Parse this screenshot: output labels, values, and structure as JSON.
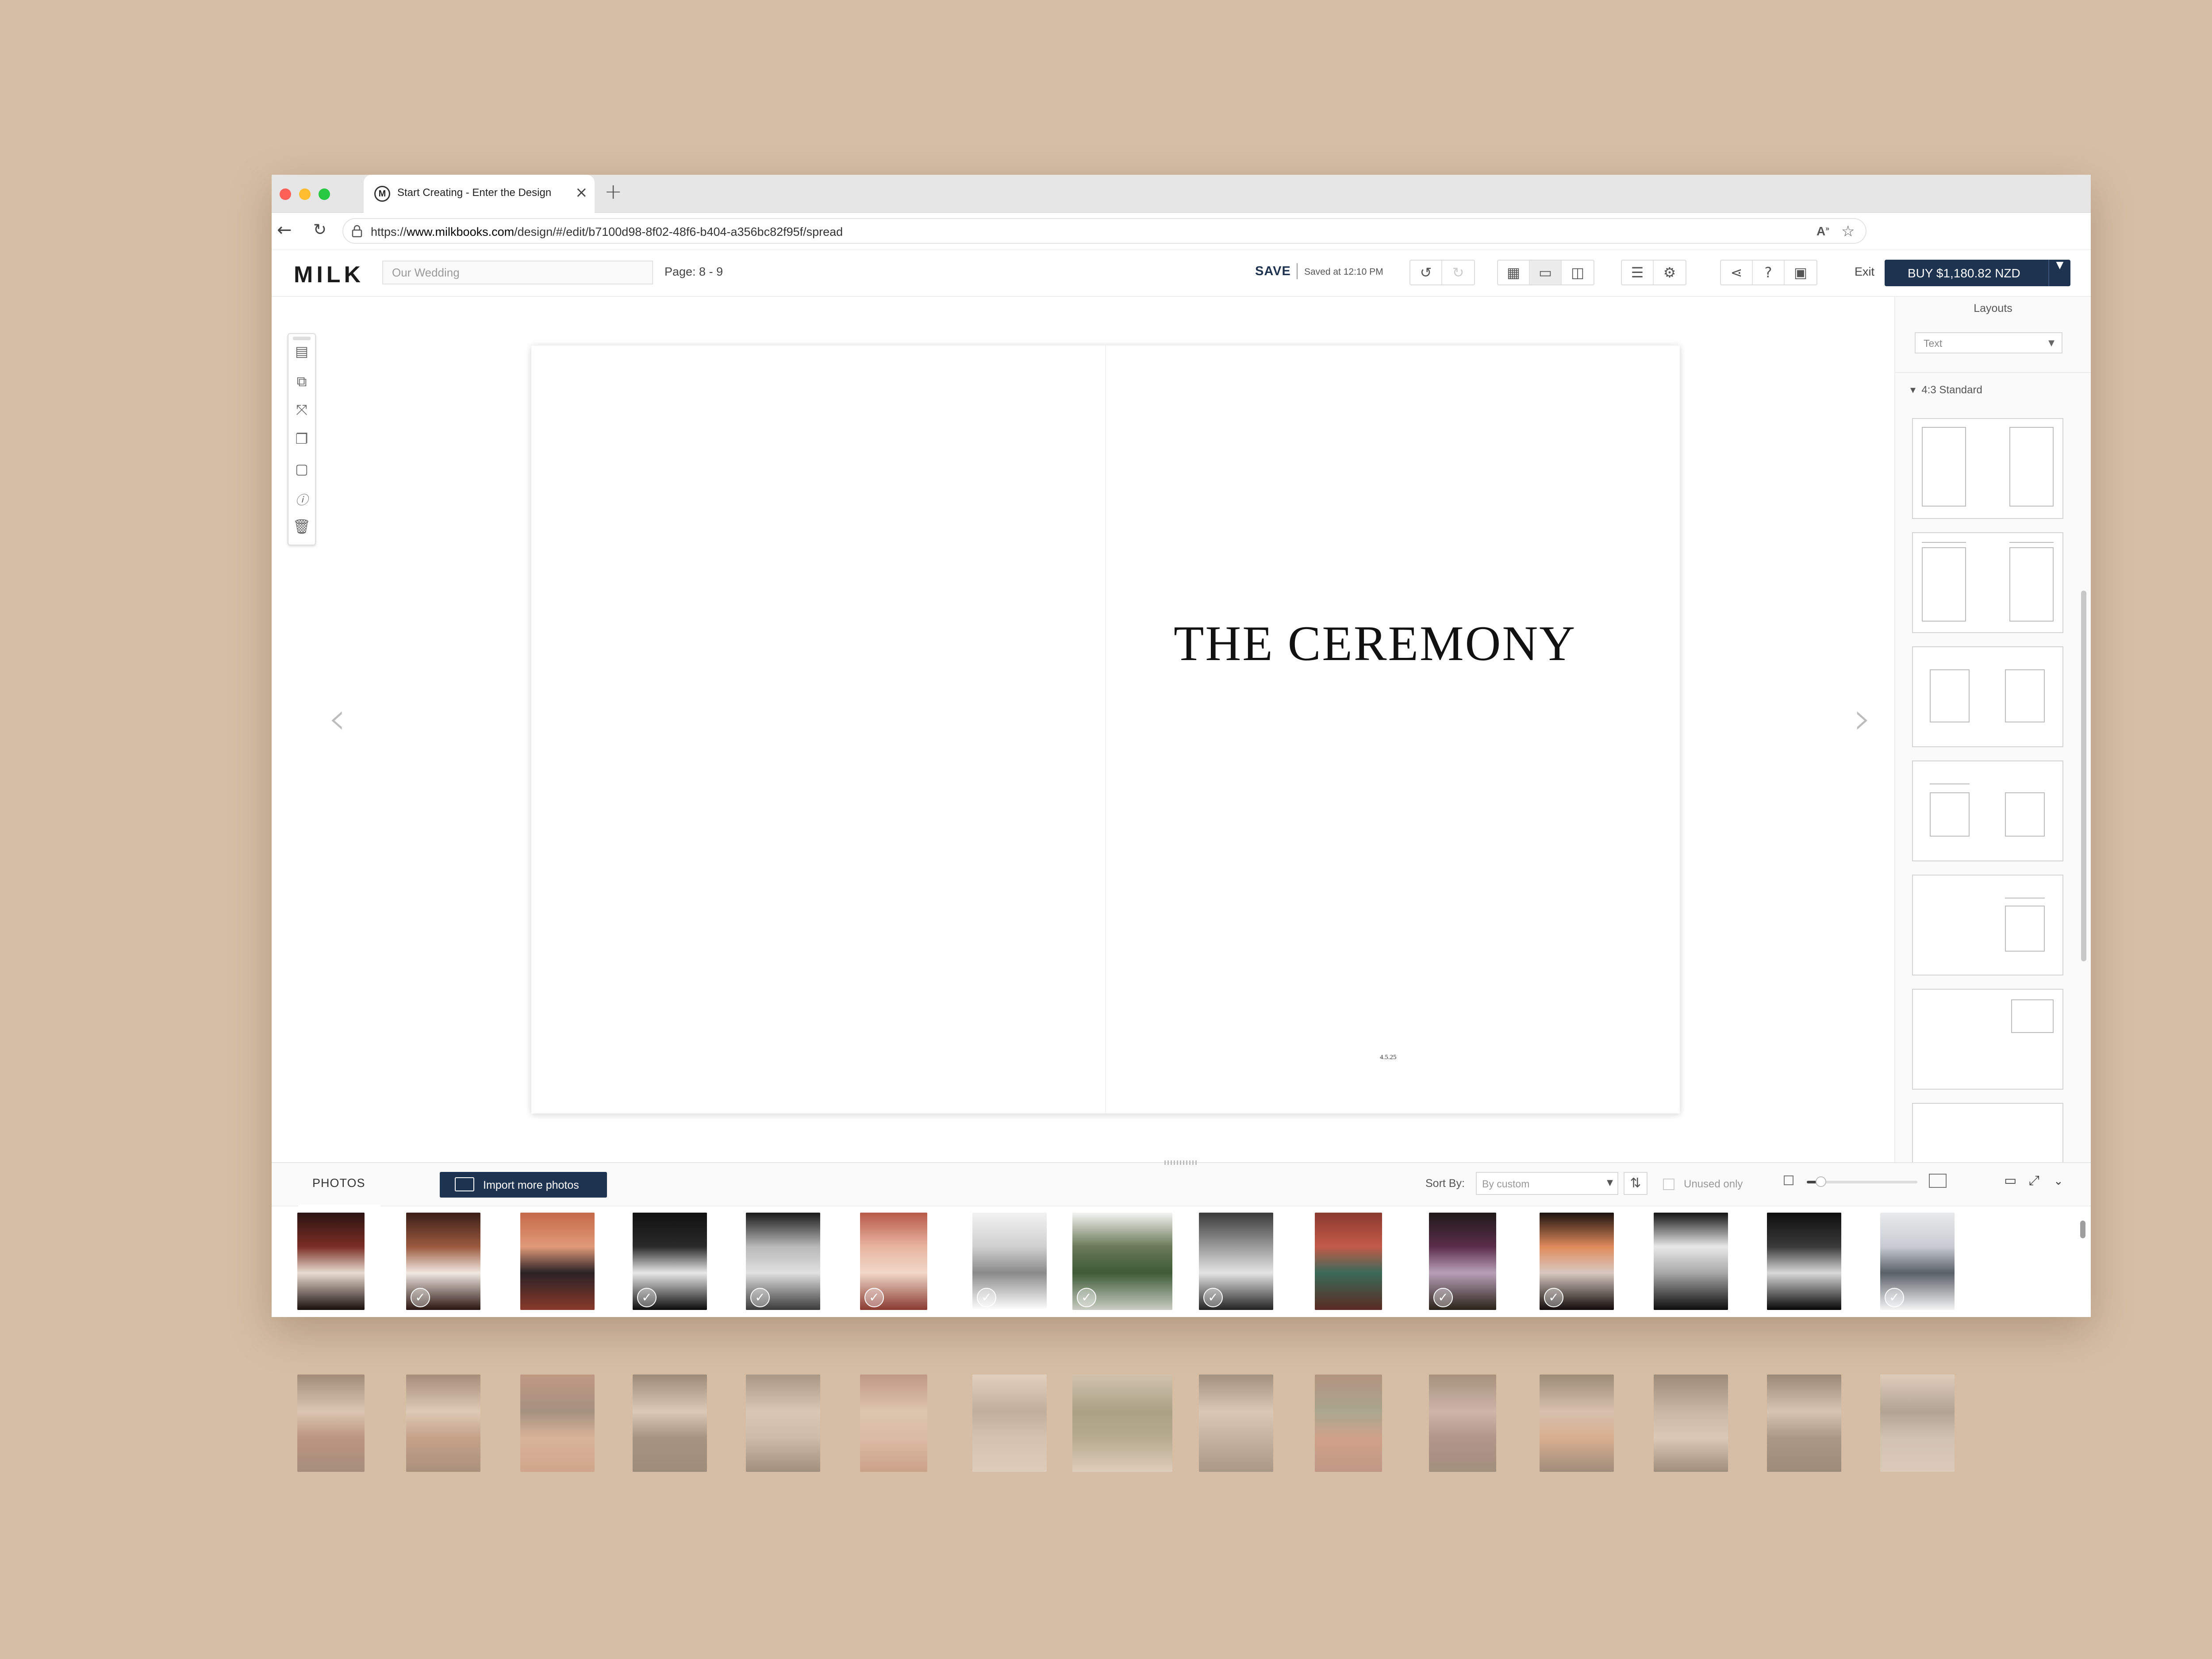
{
  "browser": {
    "tab_title": "Start Creating - Enter the Design",
    "tab_favicon_letter": "M",
    "url_prefix": "https://",
    "url_host": "www.milkbooks.com",
    "url_path": "/design/#/edit/b7100d98-8f02-48f6-b404-a356bc82f95f/spread"
  },
  "header": {
    "logo": "MILK",
    "book_title_placeholder": "Our Wedding",
    "page_indicator": "Page: 8 - 9",
    "save_label": "SAVE",
    "saved_status": "Saved at 12:10 PM",
    "exit_label": "Exit",
    "buy_label": "BUY $1,180.82 NZD"
  },
  "spread": {
    "heading": "THE CEREMONY",
    "date": "4.5.25"
  },
  "layouts_panel": {
    "title": "Layouts",
    "filter_value": "Text",
    "section_label": "4:3 Standard"
  },
  "photos_bar": {
    "tab_label": "PHOTOS",
    "import_label": "Import more photos",
    "sort_label": "Sort By:",
    "sort_value": "By custom",
    "unused_only_label": "Unused only",
    "zoom_level_fraction": 0.08
  },
  "photos": [
    {
      "name": "photo-1",
      "used": false,
      "colors": [
        "#2a1512",
        "#7a2e24",
        "#e8dcd0",
        "#1a0e0c"
      ]
    },
    {
      "name": "photo-2",
      "used": true,
      "colors": [
        "#3b1f18",
        "#9b5a3e",
        "#f0e8e0",
        "#2a1410"
      ]
    },
    {
      "name": "photo-3",
      "used": false,
      "colors": [
        "#c46a48",
        "#e09a78",
        "#2a2226",
        "#8a3a2a"
      ]
    },
    {
      "name": "photo-4",
      "used": true,
      "colors": [
        "#111111",
        "#2a2a2a",
        "#e8e8e8",
        "#0a0a0a"
      ]
    },
    {
      "name": "photo-5",
      "used": true,
      "colors": [
        "#1a1a1a",
        "#b8b8b8",
        "#e0e0e0",
        "#3a3a3a"
      ]
    },
    {
      "name": "photo-6",
      "used": true,
      "colors": [
        "#b65a48",
        "#e8b4a0",
        "#f0d8c8",
        "#8a3a30"
      ]
    },
    {
      "name": "photo-7",
      "used": true,
      "colors": [
        "#f2f2f2",
        "#d0d0d0",
        "#8a8a8a",
        "#ffffff"
      ]
    },
    {
      "name": "photo-8",
      "used": true,
      "colors": [
        "#f4f4f2",
        "#6a7a58",
        "#3e5a36",
        "#c8cdc2"
      ]
    },
    {
      "name": "photo-9",
      "used": true,
      "colors": [
        "#3a3a3a",
        "#9a9a9a",
        "#e4e4e4",
        "#222222"
      ]
    },
    {
      "name": "photo-10",
      "used": false,
      "colors": [
        "#8a3a30",
        "#c45a48",
        "#3a6a58",
        "#5a2a22"
      ]
    },
    {
      "name": "photo-11",
      "used": true,
      "colors": [
        "#1e1a18",
        "#5a2e4a",
        "#b8a0b8",
        "#2a2218"
      ]
    },
    {
      "name": "photo-12",
      "used": true,
      "colors": [
        "#1a1210",
        "#e08a5a",
        "#d8c8c0",
        "#100a08"
      ]
    },
    {
      "name": "photo-13",
      "used": false,
      "colors": [
        "#141414",
        "#e8e8e8",
        "#a8a8a8",
        "#0c0c0c"
      ]
    },
    {
      "name": "photo-14",
      "used": false,
      "colors": [
        "#0e0e0e",
        "#3a3a3a",
        "#d8d8d8",
        "#050505"
      ]
    },
    {
      "name": "photo-15",
      "used": true,
      "colors": [
        "#e8eaec",
        "#c8ccd2",
        "#5a6068",
        "#f4f4f4"
      ]
    }
  ]
}
